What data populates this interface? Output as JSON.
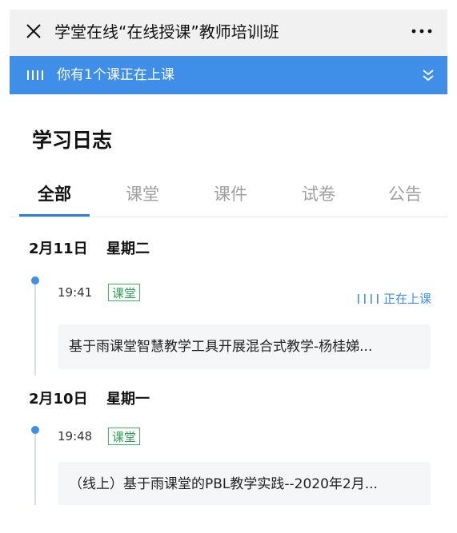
{
  "window": {
    "title": "学堂在线“在线授课”教师培训班"
  },
  "icons": {
    "close": "close-icon",
    "more": "more-dots-icon",
    "live_bars": "signal-bars-icon",
    "expand": "double-chevron-down-icon"
  },
  "banner": {
    "text": "你有1个课正在上课"
  },
  "page": {
    "title": "学习日志"
  },
  "tabs": [
    {
      "label": "全部",
      "active": true
    },
    {
      "label": "课堂",
      "active": false
    },
    {
      "label": "课件",
      "active": false
    },
    {
      "label": "试卷",
      "active": false
    },
    {
      "label": "公告",
      "active": false
    }
  ],
  "days": [
    {
      "date": "2月11日",
      "weekday": "星期二",
      "entries": [
        {
          "time": "19:41",
          "tag": "课堂",
          "status": "正在上课",
          "title": "基于雨课堂智慧教学工具开展混合式教学-杨桂娣..."
        }
      ]
    },
    {
      "date": "2月10日",
      "weekday": "星期一",
      "entries": [
        {
          "time": "19:48",
          "tag": "课堂",
          "status": "",
          "title": "（线上）基于雨课堂的PBL教学实践--2020年2月..."
        }
      ]
    }
  ],
  "colors": {
    "accent": "#3f8ee8",
    "tag_green": "#2f9e55",
    "header_bg": "#f1f1f1",
    "card_bg": "#f5f6f8"
  }
}
